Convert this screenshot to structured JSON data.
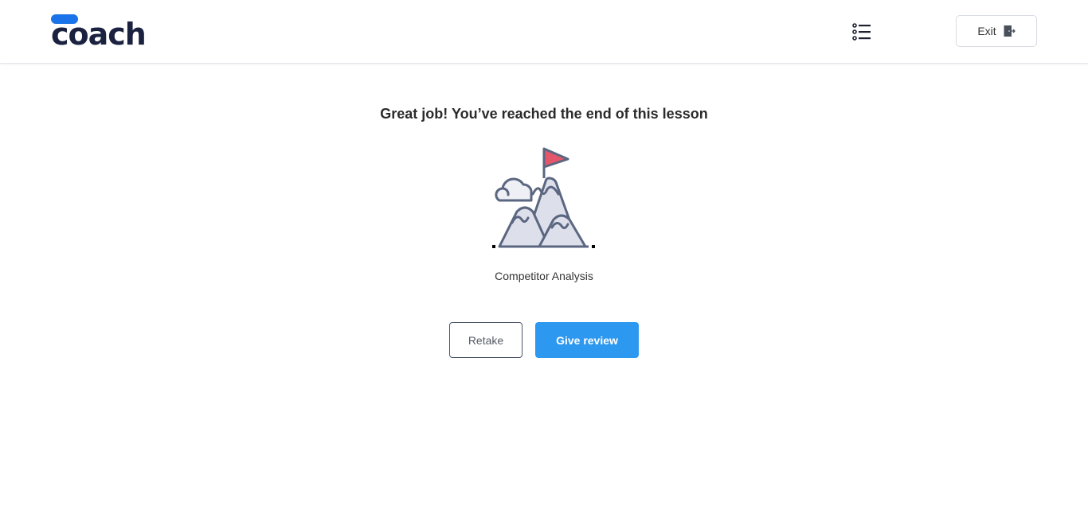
{
  "header": {
    "logo_text": "coach",
    "outline_icon": "list-icon",
    "exit_label": "Exit",
    "exit_icon": "exit-door-icon"
  },
  "main": {
    "title": "Great job! You’ve reached the end of this lesson",
    "illustration": "mountain-flag-icon",
    "lesson_name": "Competitor Analysis",
    "retake_label": "Retake",
    "review_label": "Give review"
  },
  "colors": {
    "brand_blue": "#1a73e8",
    "logo_navy": "#1b2240",
    "primary_button": "#2c98f0",
    "illustration_stroke": "#5b6681",
    "illustration_fill": "#dde0ea",
    "flag_red": "#e4576a"
  }
}
